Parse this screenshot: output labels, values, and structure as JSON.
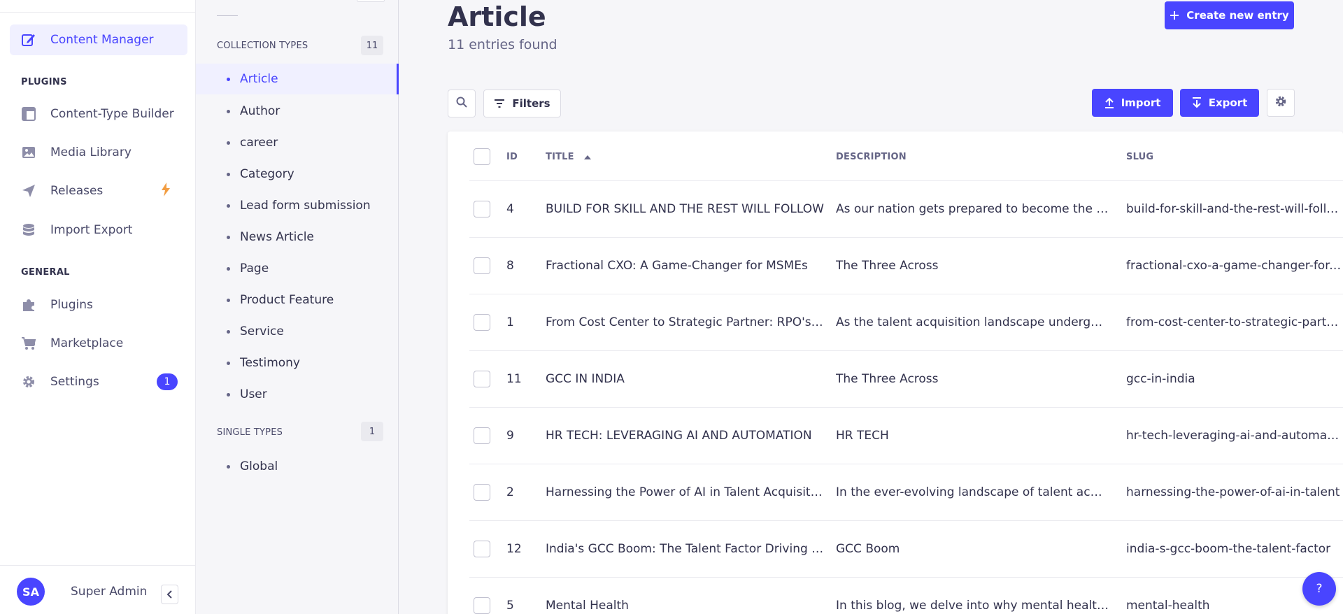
{
  "leftnav": {
    "content_manager": "Content Manager",
    "plugins_section": "PLUGINS",
    "content_type_builder": "Content-Type Builder",
    "media_library": "Media Library",
    "releases": "Releases",
    "import_export": "Import Export",
    "general_section": "GENERAL",
    "plugins": "Plugins",
    "marketplace": "Marketplace",
    "settings": "Settings",
    "settings_badge": "1",
    "avatar_initials": "SA",
    "admin_name": "Super Admin"
  },
  "subnav": {
    "collection_types_label": "COLLECTION TYPES",
    "collection_types_count": "11",
    "collection_types": [
      "Article",
      "Author",
      "career",
      "Category",
      "Lead form submission",
      "News Article",
      "Page",
      "Product Feature",
      "Service",
      "Testimony",
      "User"
    ],
    "single_types_label": "SINGLE TYPES",
    "single_types_count": "1",
    "single_types": [
      "Global"
    ]
  },
  "header": {
    "title": "Article",
    "subtitle": "11 entries found",
    "create_button": "Create new entry"
  },
  "toolbar": {
    "filters_label": "Filters",
    "import_label": "Import",
    "export_label": "Export"
  },
  "table": {
    "columns": {
      "id": "ID",
      "title": "TITLE",
      "description": "DESCRIPTION",
      "slug": "SLUG"
    },
    "rows": [
      {
        "id": "4",
        "title": "BUILD FOR SKILL AND THE REST WILL FOLLOW",
        "description": "As our nation gets prepared to become the thi…",
        "slug": "build-for-skill-and-the-rest-will-follow"
      },
      {
        "id": "8",
        "title": "Fractional CXO: A Game-Changer for MSMEs",
        "description": "The Three Across",
        "slug": "fractional-cxo-a-game-changer-for-msmes"
      },
      {
        "id": "1",
        "title": "From Cost Center to Strategic Partner: RPO's I…",
        "description": "As the talent acquisition landscape undergoes…",
        "slug": "from-cost-center-to-strategic-partner"
      },
      {
        "id": "11",
        "title": "GCC IN INDIA",
        "description": "The Three Across",
        "slug": "gcc-in-india"
      },
      {
        "id": "9",
        "title": "HR TECH: LEVERAGING AI AND AUTOMATION",
        "description": "HR TECH",
        "slug": "hr-tech-leveraging-ai-and-automation"
      },
      {
        "id": "2",
        "title": "Harnessing the Power of AI in Talent Acquisition",
        "description": "In the ever-evolving landscape of talent acqui…",
        "slug": "harnessing-the-power-of-ai-in-talent"
      },
      {
        "id": "12",
        "title": "India's GCC Boom: The Talent Factor Driving …",
        "description": "GCC Boom",
        "slug": "india-s-gcc-boom-the-talent-factor"
      },
      {
        "id": "5",
        "title": "Mental Health",
        "description": "In this blog, we delve into why mental health …",
        "slug": "mental-health"
      }
    ]
  },
  "help_label": "?",
  "colors": {
    "primary": "#4945ff",
    "accent_bolt": "#f29d41",
    "text": "#32324d",
    "muted": "#666687"
  }
}
